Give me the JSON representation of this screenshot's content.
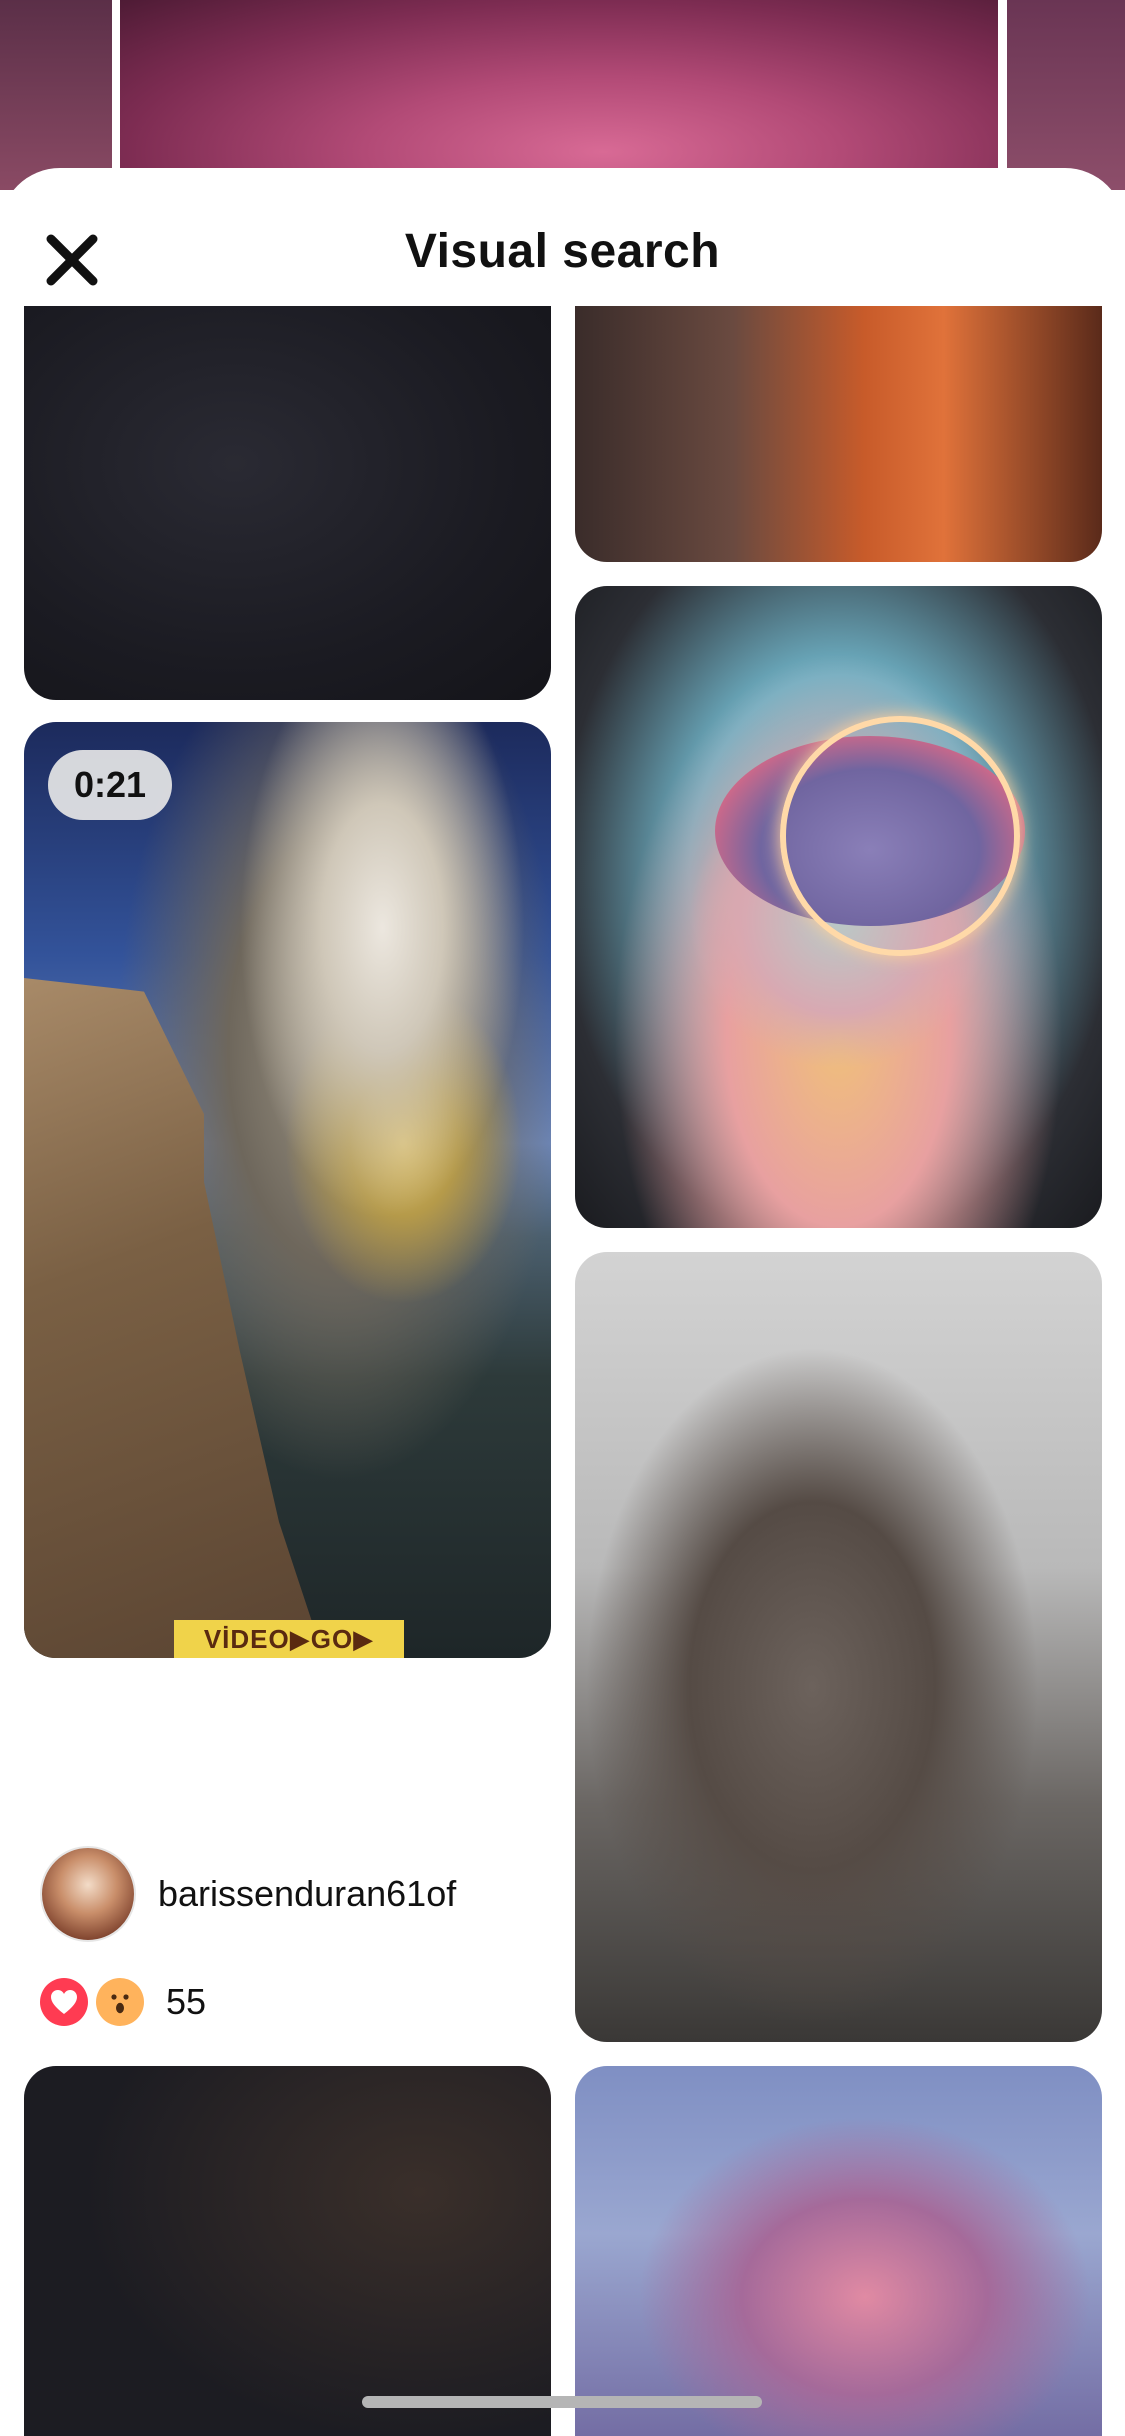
{
  "header": {
    "title": "Visual search",
    "close_icon": "close-icon"
  },
  "pins": {
    "video_pin": {
      "duration": "0:21",
      "watermark": "VİDEO▶GO▶",
      "author": "barissenduran61of",
      "reactions": [
        "heart",
        "wow"
      ],
      "reaction_count": "55"
    }
  }
}
